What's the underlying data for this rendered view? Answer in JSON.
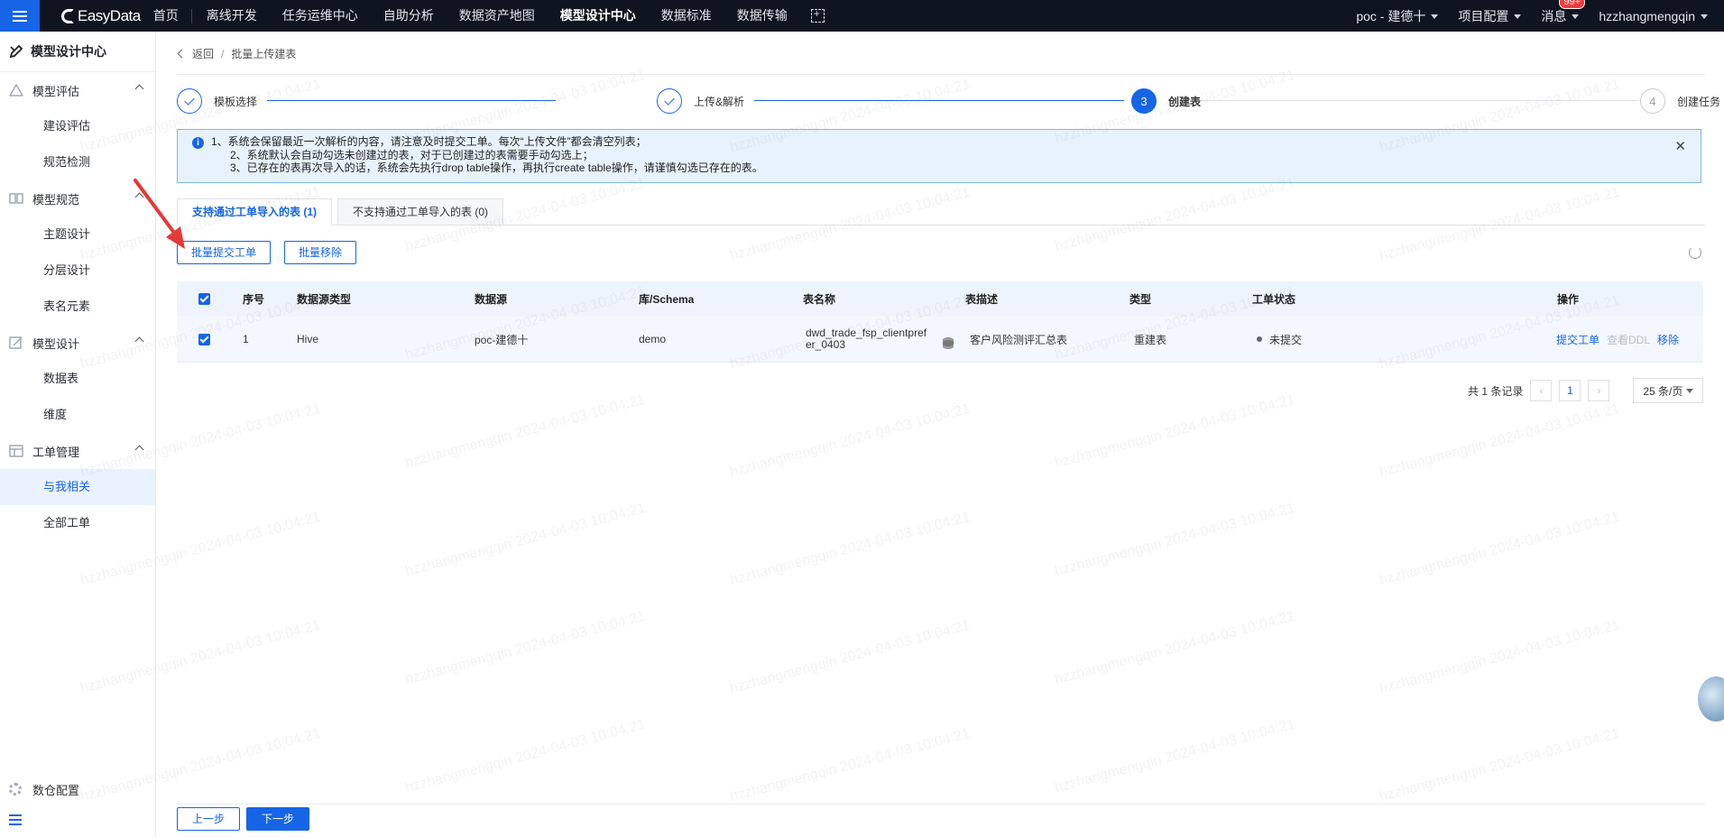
{
  "topnav": {
    "brand": "EasyData",
    "items": [
      "首页",
      "离线开发",
      "任务运维中心",
      "自助分析",
      "数据资产地图",
      "模型设计中心",
      "数据标准",
      "数据传输"
    ],
    "active": "模型设计中心",
    "project": "poc - 建德十",
    "project_config": "项目配置",
    "messages": "消息",
    "messages_badge": "99+",
    "user": "hzzhangmengqin"
  },
  "sidebar": {
    "title": "模型设计中心",
    "groups": [
      {
        "label": "模型评估",
        "items": [
          "建设评估",
          "规范检测"
        ]
      },
      {
        "label": "模型规范",
        "items": [
          "主题设计",
          "分层设计",
          "表名元素"
        ]
      },
      {
        "label": "模型设计",
        "items": [
          "数据表",
          "维度"
        ]
      },
      {
        "label": "工单管理",
        "items": [
          "与我相关",
          "全部工单"
        ]
      }
    ],
    "active_item": "与我相关",
    "bottom": "数仓配置"
  },
  "breadcrumb": {
    "back": "返回",
    "current": "批量上传建表"
  },
  "steps": [
    {
      "label": "模板选择",
      "state": "done"
    },
    {
      "label": "上传&解析",
      "state": "done"
    },
    {
      "label": "创建表",
      "number": "3",
      "state": "current"
    },
    {
      "label": "创建任务",
      "number": "4",
      "state": "todo"
    }
  ],
  "alert": {
    "line1": "1、系统会保留最近一次解析的内容，请注意及时提交工单。每次“上传文件”都会清空列表；",
    "line2": "2、系统默认会自动勾选未创建过的表，对于已创建过的表需要手动勾选上；",
    "line3": "3、已存在的表再次导入的话，系统会先执行drop table操作，再执行create table操作，请谨慎勾选已存在的表。"
  },
  "tabs": [
    "支持通过工单导入的表 (1)",
    "不支持通过工单导入的表 (0)"
  ],
  "actions": {
    "batch_submit": "批量提交工单",
    "batch_remove": "批量移除"
  },
  "table": {
    "headers": [
      "序号",
      "数据源类型",
      "数据源",
      "库/Schema",
      "表名称",
      "表描述",
      "类型",
      "工单状态",
      "操作"
    ],
    "rows": [
      {
        "index": "1",
        "source_type": "Hive",
        "source": "poc-建德十",
        "schema": "demo",
        "table_name": "dwd_trade_fsp_clientprefer_0403",
        "description": "客户风险测评汇总表",
        "type": "重建表",
        "status": "未提交",
        "ops": [
          "提交工单",
          "查看DDL",
          "移除"
        ]
      }
    ]
  },
  "pagination": {
    "total": "共 1 条记录",
    "page": "1",
    "size": "25 条/页"
  },
  "footer": {
    "prev": "上一步",
    "next": "下一步"
  },
  "watermark": "hzzhangmengqin 2024-04-03 10:04:21",
  "colors": {
    "primary": "#1565e6",
    "nav_bg": "#0e1520",
    "annotation_arrow": "#e53935"
  }
}
